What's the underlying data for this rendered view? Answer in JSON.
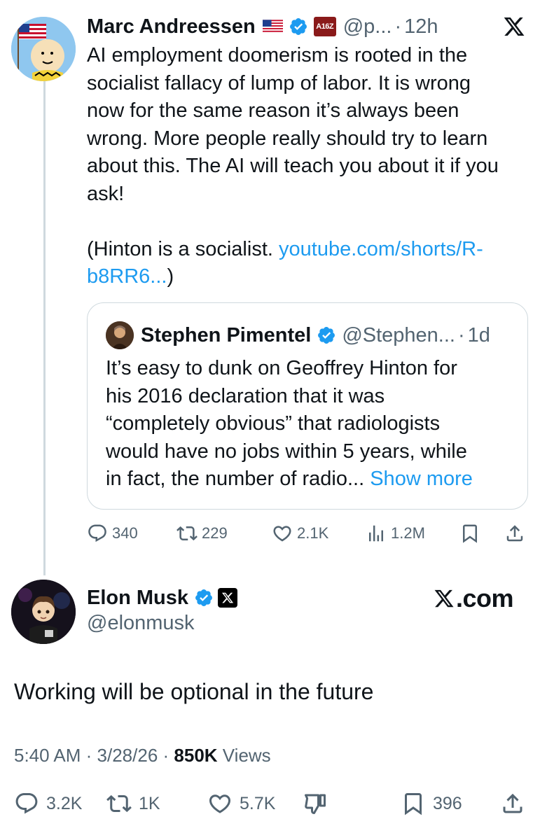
{
  "tweet1": {
    "author": {
      "name": "Marc Andreessen",
      "handle": "@p...",
      "time": "12h",
      "badge_text": "A16Z"
    },
    "text_lines": [
      "AI employment doomerism is rooted in the",
      "socialist fallacy of lump of labor. It is wrong",
      "now for the same reason it’s always been",
      "wrong. More people really should try to learn",
      "about this. The AI will teach you about it if you",
      "ask!"
    ],
    "paren_prefix": "(Hinton is a socialist. ",
    "link_line1": "youtube.com/shorts/R-",
    "link_line2": "b8RR6...",
    "paren_suffix": ")",
    "quote": {
      "name": "Stephen Pimentel",
      "handle": "@Stephen...",
      "time": "1d",
      "text_lines": [
        "It’s easy to dunk on Geoffrey Hinton for",
        "his 2016 declaration that it was",
        "“completely obvious” that radiologists",
        "would have no jobs within 5 years, while"
      ],
      "last_line": "in fact, the number of radio...",
      "show_more": "Show more"
    },
    "actions": {
      "replies": "340",
      "reposts": "229",
      "likes": "2.1K",
      "views": "1.2M"
    }
  },
  "tweet2": {
    "author": {
      "name": "Elon Musk",
      "handle": "@elonmusk"
    },
    "brand": ".com",
    "text": "Working will be optional in the future",
    "time": "5:40 AM",
    "date": "3/28/26",
    "views_count": "850K",
    "views_label": "Views",
    "actions": {
      "replies": "3.2K",
      "reposts": "1K",
      "likes": "5.7K",
      "bookmarks": "396"
    }
  },
  "colors": {
    "text": "#0f1419",
    "secondary": "#536471",
    "link": "#1d9bf0",
    "border": "#cfd9de",
    "verified": "#1d9bf0"
  }
}
